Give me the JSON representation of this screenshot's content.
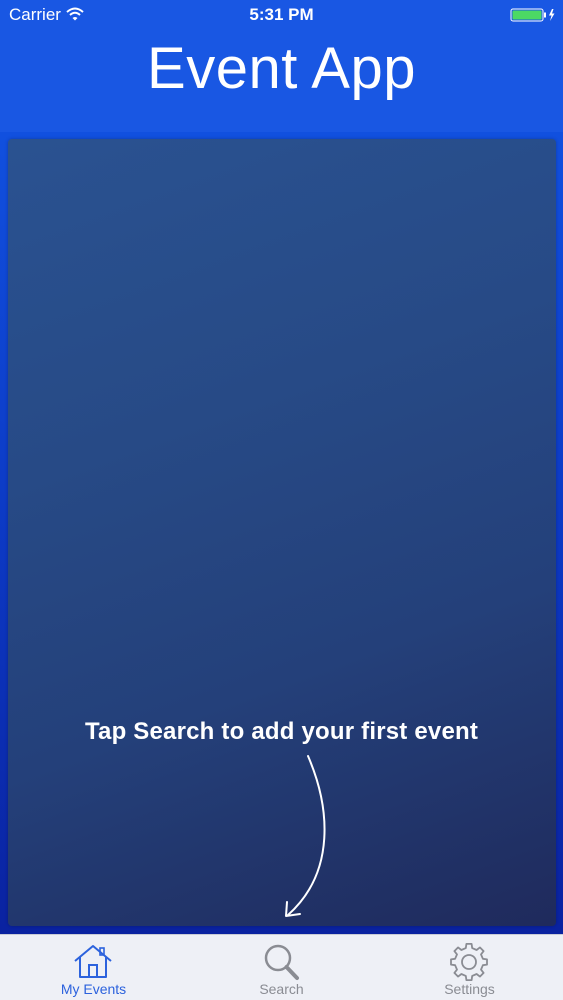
{
  "status_bar": {
    "carrier": "Carrier",
    "time": "5:31 PM",
    "wifi_icon": "wifi-icon",
    "battery_icon": "battery-charging-icon"
  },
  "header": {
    "title": "Event App"
  },
  "main": {
    "hint": "Tap Search to add your first event",
    "hint_arrow_icon": "curved-arrow-icon"
  },
  "tab_bar": {
    "tabs": [
      {
        "label": "My Events",
        "icon": "home-icon",
        "active": true
      },
      {
        "label": "Search",
        "icon": "search-icon",
        "active": false
      },
      {
        "label": "Settings",
        "icon": "gear-icon",
        "active": false
      }
    ]
  },
  "colors": {
    "header_bg": "#1957e3",
    "panel_bg": "#274a86",
    "tab_active": "#2c62dd",
    "tab_inactive": "#8a8c93",
    "battery": "#4cd964"
  }
}
